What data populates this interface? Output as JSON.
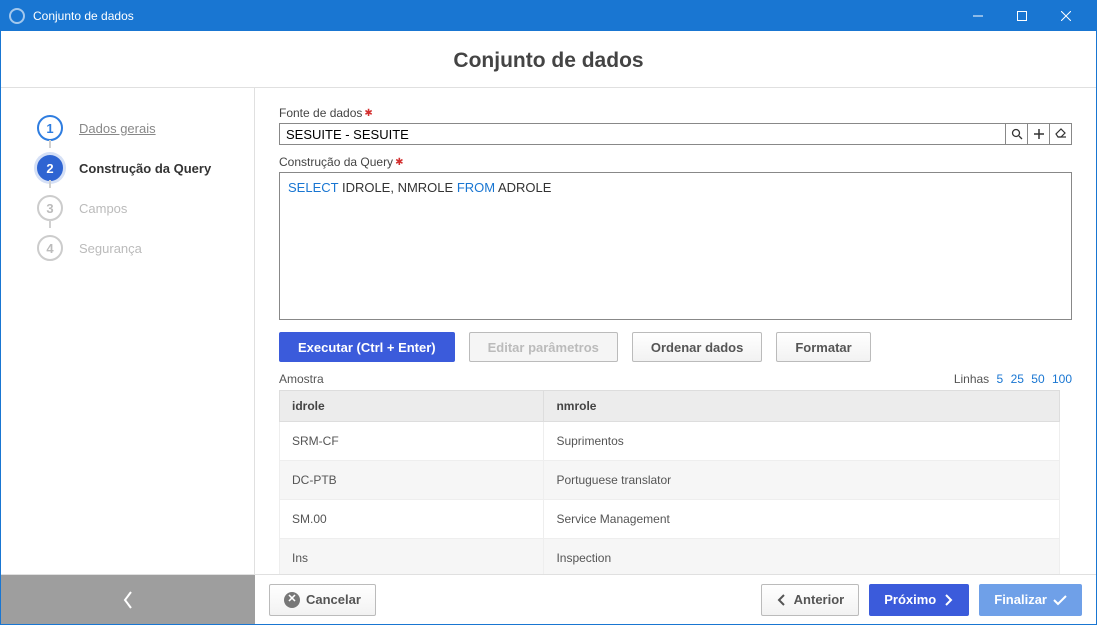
{
  "window": {
    "title": "Conjunto de dados"
  },
  "header": {
    "title": "Conjunto de dados"
  },
  "steps": [
    {
      "num": "1",
      "label": "Dados gerais",
      "state": "done"
    },
    {
      "num": "2",
      "label": "Construção da Query",
      "state": "active"
    },
    {
      "num": "3",
      "label": "Campos",
      "state": "pending"
    },
    {
      "num": "4",
      "label": "Segurança",
      "state": "pending"
    }
  ],
  "source": {
    "label": "Fonte de dados",
    "value": "SESUITE - SESUITE"
  },
  "query": {
    "label": "Construção da Query",
    "tokens": [
      {
        "t": "SELECT",
        "kw": true
      },
      {
        "t": " IDROLE, NMROLE ",
        "kw": false
      },
      {
        "t": "FROM",
        "kw": true
      },
      {
        "t": " ADROLE",
        "kw": false
      }
    ]
  },
  "buttons": {
    "execute": "Executar (Ctrl + Enter)",
    "edit_params": "Editar parâmetros",
    "order_data": "Ordenar dados",
    "format": "Formatar"
  },
  "sample": {
    "label": "Amostra",
    "rows_label": "Linhas",
    "row_options": [
      "5",
      "25",
      "50",
      "100"
    ],
    "columns": [
      "idrole",
      "nmrole"
    ],
    "rows": [
      [
        "SRM-CF",
        "Suprimentos"
      ],
      [
        "DC-PTB",
        "Portuguese translator"
      ],
      [
        "SM.00",
        "Service Management"
      ],
      [
        "Ins",
        "Inspection"
      ]
    ]
  },
  "footer": {
    "cancel": "Cancelar",
    "prev": "Anterior",
    "next": "Próximo",
    "finish": "Finalizar"
  }
}
